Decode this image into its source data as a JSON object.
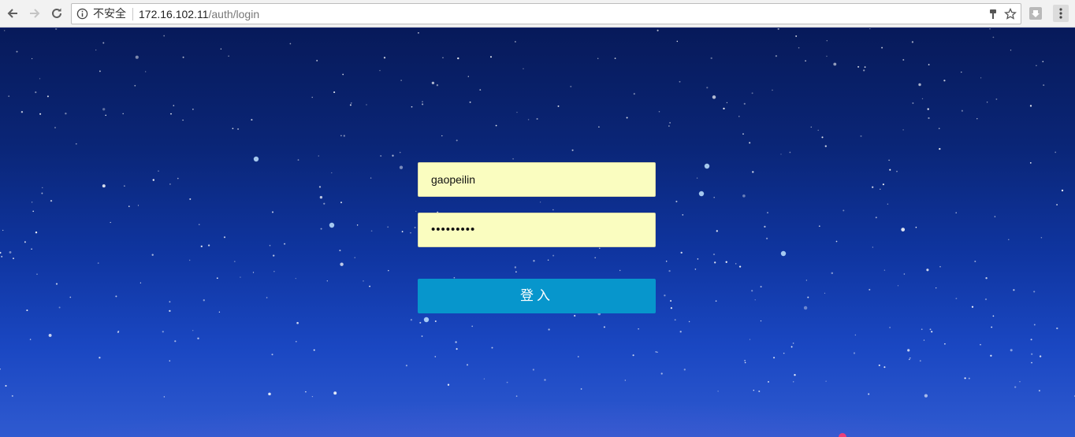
{
  "browser": {
    "security_label": "不安全",
    "url_host": "172.16.102.11",
    "url_path": "/auth/login"
  },
  "login": {
    "username_value": "gaopeilin",
    "password_masked": "•••••••••",
    "submit_label": "登入"
  },
  "icons": {
    "back": "arrow-left-icon",
    "forward": "arrow-right-icon",
    "reload": "reload-icon",
    "info": "info-icon",
    "key": "key-icon",
    "bookmark": "star-icon",
    "extension": "extension-icon",
    "menu": "kebab-menu-icon"
  },
  "colors": {
    "input_bg": "#fafdc0",
    "button_bg": "#0796cc",
    "sky_top": "#071a5a",
    "sky_bottom": "#2f5ad0"
  }
}
